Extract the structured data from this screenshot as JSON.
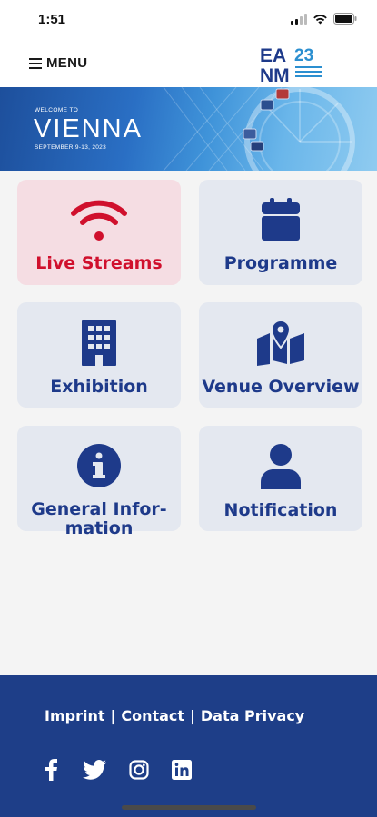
{
  "status_bar": {
    "time": "1:51"
  },
  "header": {
    "menu_label": "MENU"
  },
  "logo": {
    "line1": "EA",
    "number": "23",
    "line2": "NM"
  },
  "banner": {
    "welcome": "WELCOME TO",
    "city": "VIENNA",
    "dates": "SEPTEMBER 9-13, 2023"
  },
  "tiles": [
    {
      "label": "Live Streams",
      "icon": "wifi-icon",
      "active": true
    },
    {
      "label": "Programme",
      "icon": "calendar-icon",
      "active": false
    },
    {
      "label": "Exhibition",
      "icon": "building-icon",
      "active": false
    },
    {
      "label": "Venue Overview",
      "icon": "map-pin-icon",
      "active": false
    },
    {
      "label_line1": "General Infor-",
      "label_line2": "mation",
      "icon": "info-icon",
      "active": false
    },
    {
      "label": "Notification",
      "icon": "user-icon",
      "active": false
    }
  ],
  "footer": {
    "links": [
      "Imprint",
      "Contact",
      "Data Privacy"
    ],
    "separator": "|",
    "social": [
      "facebook-icon",
      "twitter-icon",
      "instagram-icon",
      "linkedin-icon"
    ]
  },
  "colors": {
    "primary": "#1e3a8a",
    "accent": "#d0102d",
    "tile_bg": "#e4e8f0",
    "tile_active_bg": "#f5dde3",
    "footer_bg": "#1e3e88"
  }
}
